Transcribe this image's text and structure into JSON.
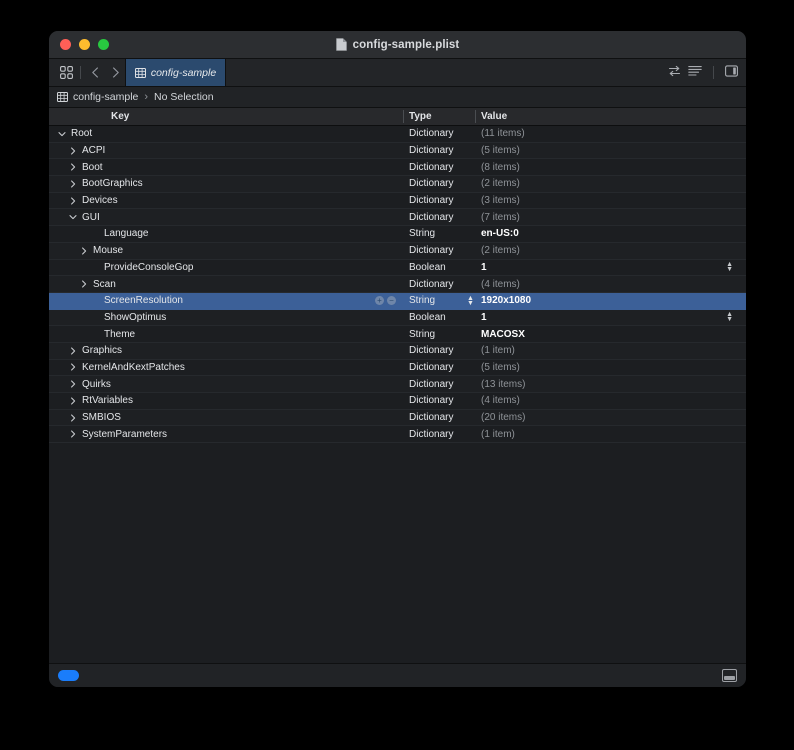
{
  "window": {
    "title": "config-sample.plist",
    "doc_icon": "document-icon",
    "traffic_lights": [
      "close",
      "minimize",
      "zoom"
    ]
  },
  "toolbar": {
    "grid_icon": "grid-icon",
    "back_icon": "chevron-left-icon",
    "forward_icon": "chevron-right-icon",
    "tab": {
      "label": "config-sample",
      "icon": "table-icon"
    },
    "right_icons": [
      "swap-arrows-icon",
      "list-lines-icon",
      "sidebar-toggle-icon"
    ]
  },
  "breadcrumb": {
    "icon": "table-icon",
    "root": "config-sample",
    "separator": "›",
    "selection": "No Selection"
  },
  "table": {
    "columns": [
      "Key",
      "Type",
      "Value"
    ],
    "rows": [
      {
        "key": "Root",
        "indent": 0,
        "twisty": "down",
        "type": "Dictionary",
        "value": "(11 items)",
        "value_style": "dim",
        "selected": false,
        "stepper": false
      },
      {
        "key": "ACPI",
        "indent": 1,
        "twisty": "right",
        "type": "Dictionary",
        "value": "(5 items)",
        "value_style": "dim",
        "selected": false,
        "stepper": false
      },
      {
        "key": "Boot",
        "indent": 1,
        "twisty": "right",
        "type": "Dictionary",
        "value": "(8 items)",
        "value_style": "dim",
        "selected": false,
        "stepper": false
      },
      {
        "key": "BootGraphics",
        "indent": 1,
        "twisty": "right",
        "type": "Dictionary",
        "value": "(2 items)",
        "value_style": "dim",
        "selected": false,
        "stepper": false
      },
      {
        "key": "Devices",
        "indent": 1,
        "twisty": "right",
        "type": "Dictionary",
        "value": "(3 items)",
        "value_style": "dim",
        "selected": false,
        "stepper": false
      },
      {
        "key": "GUI",
        "indent": 1,
        "twisty": "down",
        "type": "Dictionary",
        "value": "(7 items)",
        "value_style": "dim",
        "selected": false,
        "stepper": false
      },
      {
        "key": "Language",
        "indent": 3,
        "twisty": "none",
        "type": "String",
        "value": "en-US:0",
        "value_style": "bold",
        "selected": false,
        "stepper": false
      },
      {
        "key": "Mouse",
        "indent": 2,
        "twisty": "right",
        "type": "Dictionary",
        "value": "(2 items)",
        "value_style": "dim",
        "selected": false,
        "stepper": false
      },
      {
        "key": "ProvideConsoleGop",
        "indent": 3,
        "twisty": "none",
        "type": "Boolean",
        "value": "1",
        "value_style": "bold",
        "selected": false,
        "stepper": true
      },
      {
        "key": "Scan",
        "indent": 2,
        "twisty": "right",
        "type": "Dictionary",
        "value": "(4 items)",
        "value_style": "dim",
        "selected": false,
        "stepper": false
      },
      {
        "key": "ScreenResolution",
        "indent": 3,
        "twisty": "none",
        "type": "String",
        "value": "1920x1080",
        "value_style": "bold",
        "selected": true,
        "stepper": false
      },
      {
        "key": "ShowOptimus",
        "indent": 3,
        "twisty": "none",
        "type": "Boolean",
        "value": "1",
        "value_style": "bold",
        "selected": false,
        "stepper": true
      },
      {
        "key": "Theme",
        "indent": 3,
        "twisty": "none",
        "type": "String",
        "value": "MACOSX",
        "value_style": "bold",
        "selected": false,
        "stepper": false
      },
      {
        "key": "Graphics",
        "indent": 1,
        "twisty": "right",
        "type": "Dictionary",
        "value": "(1 item)",
        "value_style": "dim",
        "selected": false,
        "stepper": false
      },
      {
        "key": "KernelAndKextPatches",
        "indent": 1,
        "twisty": "right",
        "type": "Dictionary",
        "value": "(5 items)",
        "value_style": "dim",
        "selected": false,
        "stepper": false
      },
      {
        "key": "Quirks",
        "indent": 1,
        "twisty": "right",
        "type": "Dictionary",
        "value": "(13 items)",
        "value_style": "dim",
        "selected": false,
        "stepper": false
      },
      {
        "key": "RtVariables",
        "indent": 1,
        "twisty": "right",
        "type": "Dictionary",
        "value": "(4 items)",
        "value_style": "dim",
        "selected": false,
        "stepper": false
      },
      {
        "key": "SMBIOS",
        "indent": 1,
        "twisty": "right",
        "type": "Dictionary",
        "value": "(20 items)",
        "value_style": "dim",
        "selected": false,
        "stepper": false
      },
      {
        "key": "SystemParameters",
        "indent": 1,
        "twisty": "right",
        "type": "Dictionary",
        "value": "(1 item)",
        "value_style": "dim",
        "selected": false,
        "stepper": false
      }
    ],
    "selected_row_buttons": {
      "add": "+",
      "remove": "−"
    }
  },
  "statusbar": {
    "pill": "blue-pill-indicator",
    "right_icon": "bottom-panel-icon"
  },
  "colors": {
    "selection": "#3c6098",
    "tab_active": "#2b4a6e",
    "accent": "#1a7dfb",
    "window_bg": "#1c1e21",
    "titlebar_bg": "#2c2e31"
  }
}
